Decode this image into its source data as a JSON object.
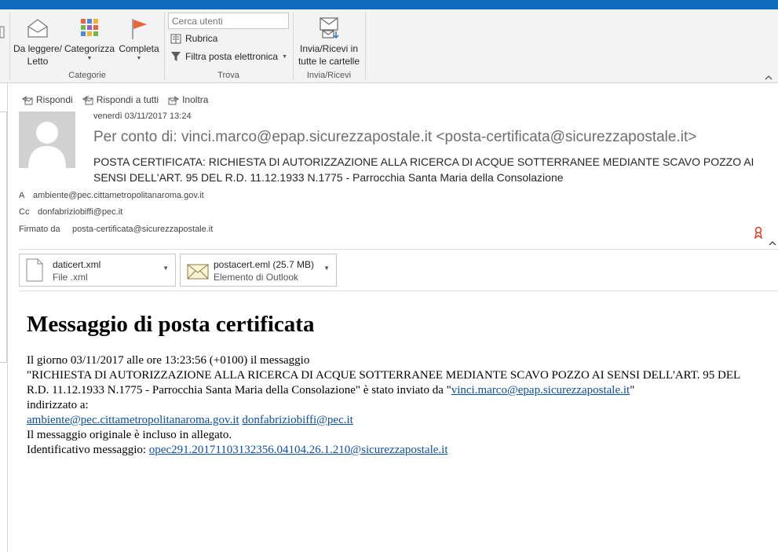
{
  "ribbon": {
    "groups": [
      {
        "label": "Categorie"
      },
      {
        "label": "Trova"
      },
      {
        "label": "Invia/Ricevi"
      }
    ],
    "btn_read": "Da leggere/\nLetto",
    "btn_read_l1": "Da leggere/",
    "btn_read_l2": "Letto",
    "btn_categorize": "Categorizza",
    "btn_complete": "Completa",
    "search_placeholder": "Cerca utenti",
    "rubrica": "Rubrica",
    "filtra": "Filtra posta elettronica",
    "btn_sendrecv_l1": "Invia/Ricevi in",
    "btn_sendrecv_l2": "tutte le cartelle"
  },
  "actions": {
    "reply": "Rispondi",
    "reply_all": "Rispondi a tutti",
    "forward": "Inoltra"
  },
  "message": {
    "date": "venerdì 03/11/2017 13:24",
    "sender": "Per conto di: vinci.marco@epap.sicurezzapostale.it <posta-certificata@sicurezzapostale.it>",
    "subject": "POSTA CERTIFICATA: RICHIESTA DI AUTORIZZAZIONE ALLA RICERCA DI ACQUE SOTTERRANEE MEDIANTE SCAVO POZZO AI SENSI DELL'ART. 95 DEL R.D. 11.12.1933 N.1775 - Parrocchia Santa Maria della Consolazione",
    "to_label": "A",
    "to_value": "ambiente@pec.cittametropolitanaroma.gov.it",
    "cc_label": "Cc",
    "cc_value": "donfabriziobiffi@pec.it",
    "signed_label": "Firmato da",
    "signed_value": "posta-certificata@sicurezzapostale.it"
  },
  "attachments": [
    {
      "name": "daticert.xml",
      "type": "File .xml",
      "icon": "document-icon"
    },
    {
      "name": "postacert.eml (25.7 MB)",
      "type": "Elemento di Outlook",
      "icon": "envelope-icon"
    }
  ],
  "body": {
    "heading": "Messaggio di posta certificata",
    "line1": "Il giorno 03/11/2017 alle ore 13:23:56 (+0100) il messaggio",
    "line2_a": "\"RICHIESTA DI AUTORIZZAZIONE ALLA RICERCA DI ACQUE SOTTERRANEE MEDIANTE SCAVO POZZO AI SENSI DELL'ART. 95 DEL R.D. 11.12.1933 N.1775 - Parrocchia Santa Maria della Consolazione\" è stato inviato da \"",
    "line2_link": "vinci.marco@epap.sicurezzapostale.it",
    "line2_b": "\"",
    "line3": "indirizzato a:",
    "recipient1": "ambiente@pec.cittametropolitanaroma.gov.it",
    "recipient2": "donfabriziobiffi@pec.it",
    "line5": "Il messaggio originale è incluso in allegato.",
    "line6_label": "Identificativo messaggio: ",
    "line6_link": "opec291.20171103132356.04104.26.1.210@sicurezzapostale.it"
  },
  "colors": {
    "titlebar": "#0f6cbd",
    "link": "#0b4fa6",
    "flag": "#e8643c"
  }
}
